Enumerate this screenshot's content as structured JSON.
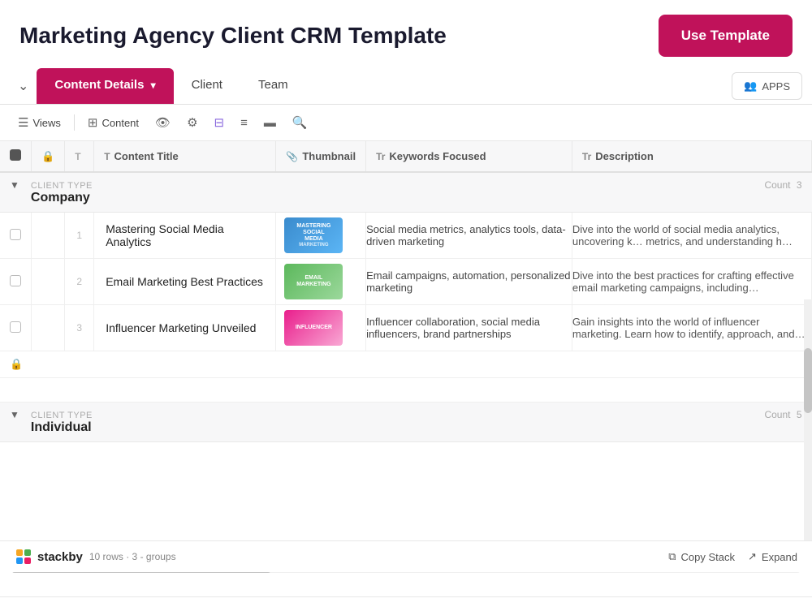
{
  "header": {
    "title": "Marketing Agency Client CRM Template",
    "use_template_label": "Use Template"
  },
  "tabs": {
    "collapse_icon": "⌄",
    "items": [
      {
        "id": "content-details",
        "label": "Content Details",
        "active": true
      },
      {
        "id": "client",
        "label": "Client",
        "active": false
      },
      {
        "id": "team",
        "label": "Team",
        "active": false
      }
    ],
    "apps_label": "APPS"
  },
  "toolbar": {
    "views_label": "Views",
    "content_label": "Content"
  },
  "columns": [
    {
      "id": "checkbox",
      "label": ""
    },
    {
      "id": "lock",
      "label": ""
    },
    {
      "id": "type",
      "label": ""
    },
    {
      "id": "content-title",
      "label": "Content Title",
      "icon": "T"
    },
    {
      "id": "thumbnail",
      "label": "Thumbnail",
      "icon": "📎"
    },
    {
      "id": "keywords",
      "label": "Keywords Focused",
      "icon": "Tr"
    },
    {
      "id": "description",
      "label": "Description",
      "icon": "Tr"
    }
  ],
  "groups": [
    {
      "id": "company",
      "label": "CLIENT TYPE",
      "name": "Company",
      "count_label": "Count",
      "count": 3,
      "rows": [
        {
          "num": 1,
          "title": "Mastering Social Media Analytics",
          "thumbnail_type": "blue",
          "thumbnail_lines": [
            "MASTERING",
            "SOCIAL",
            "MEDIA",
            "MARKETING"
          ],
          "keywords": "Social media metrics, analytics tools, data-driven marketing",
          "description": "Dive into the world of social media analytics, uncovering k… metrics, and understanding h…"
        },
        {
          "num": 2,
          "title": "Email Marketing Best Practices",
          "thumbnail_type": "green",
          "thumbnail_lines": [
            "EMAIL",
            "MARKETING"
          ],
          "keywords": "Email campaigns, automation, personalized marketing",
          "description": "Dive into the best practices for crafting effective email marketing campaigns, including…"
        },
        {
          "num": 3,
          "title": "Influencer Marketing Unveiled",
          "thumbnail_type": "pink",
          "thumbnail_lines": [
            "INFLUENCER"
          ],
          "keywords": "Influencer collaboration, social media influencers, brand partnerships",
          "description": "Gain insights into the world of influencer marketing. Learn how to identify, approach, and…"
        }
      ]
    },
    {
      "id": "individual",
      "label": "CLIENT TYPE",
      "name": "Individual",
      "count_label": "Count",
      "count": 5,
      "rows": []
    }
  ],
  "footer": {
    "logo_text": "stackby",
    "rows_info": "10 rows · 3 - groups",
    "copy_stack_label": "Copy Stack",
    "expand_label": "Expand"
  }
}
